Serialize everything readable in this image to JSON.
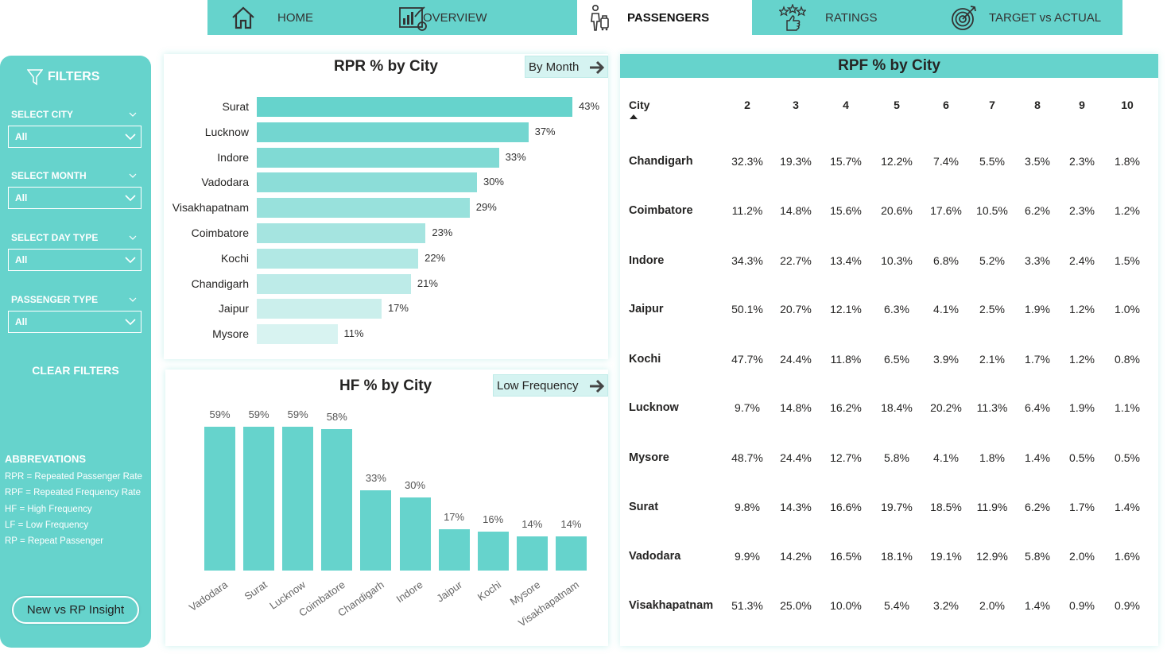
{
  "nav": {
    "tabs": [
      {
        "label": "HOME",
        "icon": "home-icon",
        "active": false
      },
      {
        "label": "OVERVIEW",
        "icon": "dashboard-icon",
        "active": false
      },
      {
        "label": "PASSENGERS",
        "icon": "passengers-icon",
        "active": true
      },
      {
        "label": "RATINGS",
        "icon": "rating-stars-icon",
        "active": false
      },
      {
        "label": "TARGET vs ACTUAL",
        "icon": "target-icon",
        "active": false
      }
    ]
  },
  "sidebar": {
    "title": "FILTERS",
    "filters": [
      {
        "label": "SELECT CITY",
        "value": "All"
      },
      {
        "label": "SELECT MONTH",
        "value": "All"
      },
      {
        "label": "SELECT DAY TYPE",
        "value": "All"
      },
      {
        "label": "PASSENGER TYPE",
        "value": "All"
      }
    ],
    "clear_label": "CLEAR FILTERS",
    "abbrev_title": "ABBREVATIONS",
    "abbreviations": [
      "RPR = Repeated Passenger Rate",
      "RPF = Repeated Frequency Rate",
      "HF = High Frequency",
      "LF = Low Frequency",
      "RP = Repeat Passenger"
    ],
    "insight_button": "New vs RP Insight"
  },
  "colors": {
    "accent": "#66d3cc",
    "toggle_bg": "#d5f3f1"
  },
  "rpr": {
    "toggle_label": "By Month",
    "chart_data": {
      "type": "bar",
      "orientation": "horizontal",
      "title": "RPR % by City",
      "categories": [
        "Surat",
        "Lucknow",
        "Indore",
        "Vadodara",
        "Visakhapatnam",
        "Coimbatore",
        "Kochi",
        "Chandigarh",
        "Jaipur",
        "Mysore"
      ],
      "values": [
        43,
        37,
        33,
        30,
        29,
        23,
        22,
        21,
        17,
        11
      ],
      "labels": [
        "43%",
        "37%",
        "33%",
        "30%",
        "29%",
        "23%",
        "22%",
        "21%",
        "17%",
        "11%"
      ],
      "xlim": [
        0,
        43
      ]
    }
  },
  "hf": {
    "toggle_label": "Low Frequency",
    "chart_data": {
      "type": "bar",
      "title": "HF % by City",
      "categories": [
        "Vadodara",
        "Surat",
        "Lucknow",
        "Coimbatore",
        "Chandigarh",
        "Indore",
        "Jaipur",
        "Kochi",
        "Mysore",
        "Visakhapatnam"
      ],
      "values": [
        59,
        59,
        59,
        58,
        33,
        30,
        17,
        16,
        14,
        14
      ],
      "labels": [
        "59%",
        "59%",
        "59%",
        "58%",
        "33%",
        "30%",
        "17%",
        "16%",
        "14%",
        "14%"
      ],
      "ylim": [
        0,
        59
      ]
    }
  },
  "rpf": {
    "title": "RPF % by City",
    "city_header": "City",
    "columns": [
      "2",
      "3",
      "4",
      "5",
      "6",
      "7",
      "8",
      "9",
      "10"
    ],
    "rows": [
      {
        "city": "Chandigarh",
        "values": [
          "32.3%",
          "19.3%",
          "15.7%",
          "12.2%",
          "7.4%",
          "5.5%",
          "3.5%",
          "2.3%",
          "1.8%"
        ]
      },
      {
        "city": "Coimbatore",
        "values": [
          "11.2%",
          "14.8%",
          "15.6%",
          "20.6%",
          "17.6%",
          "10.5%",
          "6.2%",
          "2.3%",
          "1.2%"
        ]
      },
      {
        "city": "Indore",
        "values": [
          "34.3%",
          "22.7%",
          "13.4%",
          "10.3%",
          "6.8%",
          "5.2%",
          "3.3%",
          "2.4%",
          "1.5%"
        ]
      },
      {
        "city": "Jaipur",
        "values": [
          "50.1%",
          "20.7%",
          "12.1%",
          "6.3%",
          "4.1%",
          "2.5%",
          "1.9%",
          "1.2%",
          "1.0%"
        ]
      },
      {
        "city": "Kochi",
        "values": [
          "47.7%",
          "24.4%",
          "11.8%",
          "6.5%",
          "3.9%",
          "2.1%",
          "1.7%",
          "1.2%",
          "0.8%"
        ]
      },
      {
        "city": "Lucknow",
        "values": [
          "9.7%",
          "14.8%",
          "16.2%",
          "18.4%",
          "20.2%",
          "11.3%",
          "6.4%",
          "1.9%",
          "1.1%"
        ]
      },
      {
        "city": "Mysore",
        "values": [
          "48.7%",
          "24.4%",
          "12.7%",
          "5.8%",
          "4.1%",
          "1.8%",
          "1.4%",
          "0.5%",
          "0.5%"
        ]
      },
      {
        "city": "Surat",
        "values": [
          "9.8%",
          "14.3%",
          "16.6%",
          "19.7%",
          "18.5%",
          "11.9%",
          "6.2%",
          "1.7%",
          "1.4%"
        ]
      },
      {
        "city": "Vadodara",
        "values": [
          "9.9%",
          "14.2%",
          "16.5%",
          "18.1%",
          "19.1%",
          "12.9%",
          "5.8%",
          "2.0%",
          "1.6%"
        ]
      },
      {
        "city": "Visakhapatnam",
        "values": [
          "51.3%",
          "25.0%",
          "10.0%",
          "5.4%",
          "3.2%",
          "2.0%",
          "1.4%",
          "0.9%",
          "0.9%"
        ]
      }
    ]
  }
}
